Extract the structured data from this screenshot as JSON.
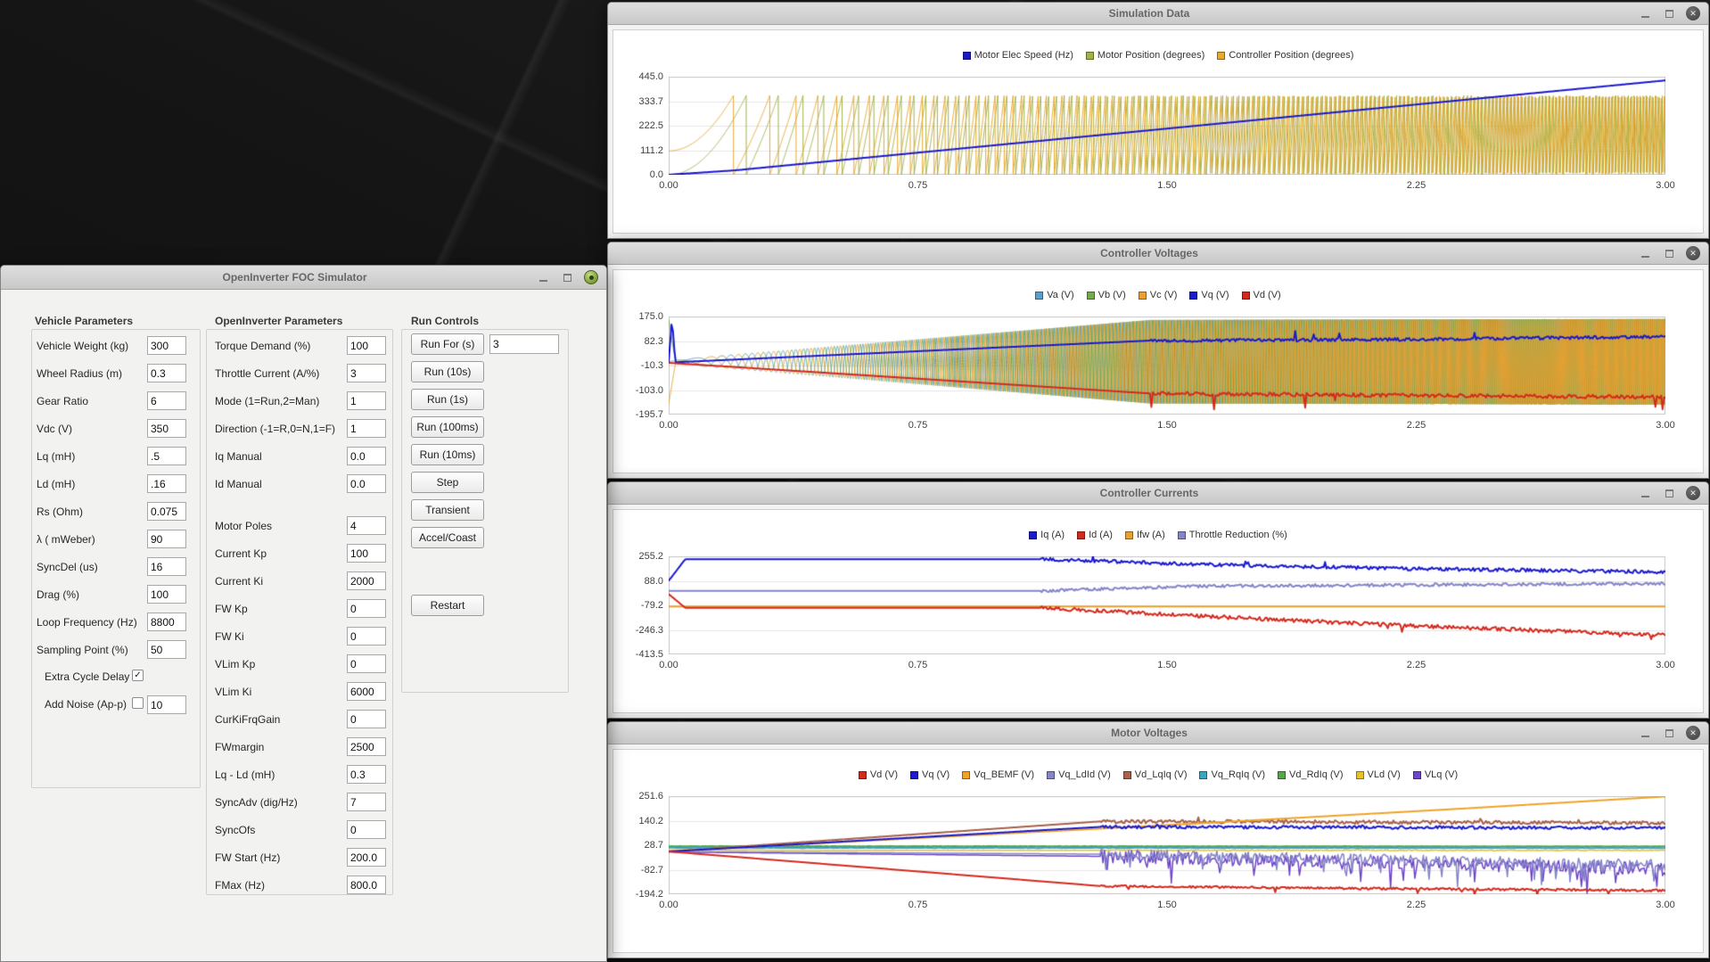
{
  "icons": {
    "close": "✕"
  },
  "simulator": {
    "title": "OpenInverter FOC Simulator",
    "groups": {
      "vehicle": {
        "heading": "Vehicle Parameters",
        "fields": [
          {
            "label": "Vehicle Weight (kg)",
            "value": "300"
          },
          {
            "label": "Wheel Radius (m)",
            "value": "0.3"
          },
          {
            "label": "Gear Ratio",
            "value": "6"
          },
          {
            "label": "Vdc (V)",
            "value": "350"
          },
          {
            "label": "Lq (mH)",
            "value": ".5"
          },
          {
            "label": "Ld (mH)",
            "value": ".16"
          },
          {
            "label": "Rs (Ohm)",
            "value": "0.075"
          },
          {
            "label": "λ ( mWeber)",
            "value": "90"
          },
          {
            "label": "SyncDel (us)",
            "value": "16"
          },
          {
            "label": "Drag (%)",
            "value": "100"
          },
          {
            "label": "Loop Frequency (Hz)",
            "value": "8800"
          },
          {
            "label": "Sampling Point (%)",
            "value": "50"
          }
        ],
        "checks": [
          {
            "label": "Extra Cycle Delay",
            "checked": true
          },
          {
            "label": "Add Noise (Ap-p)",
            "checked": false,
            "value": "10"
          }
        ]
      },
      "openinverter": {
        "heading": "OpenInverter Parameters",
        "fields": [
          {
            "label": "Torque Demand (%)",
            "value": "100"
          },
          {
            "label": "Throttle Current (A/%)",
            "value": "3"
          },
          {
            "label": "Mode (1=Run,2=Man)",
            "value": "1"
          },
          {
            "label": "Direction (-1=R,0=N,1=F)",
            "value": "1"
          },
          {
            "label": "Iq Manual",
            "value": "0.0"
          },
          {
            "label": "Id Manual",
            "value": "0.0"
          },
          {
            "label": "Motor Poles",
            "value": "4"
          },
          {
            "label": "Current Kp",
            "value": "100"
          },
          {
            "label": "Current Ki",
            "value": "2000"
          },
          {
            "label": "FW Kp",
            "value": "0"
          },
          {
            "label": "FW Ki",
            "value": "0"
          },
          {
            "label": "VLim Kp",
            "value": "0"
          },
          {
            "label": "VLim Ki",
            "value": "6000"
          },
          {
            "label": "CurKiFrqGain",
            "value": "0"
          },
          {
            "label": "FWmargin",
            "value": "2500"
          },
          {
            "label": "Lq - Ld (mH)",
            "value": "0.3"
          },
          {
            "label": "SyncAdv (dig/Hz)",
            "value": "7"
          },
          {
            "label": "SyncOfs",
            "value": "0"
          },
          {
            "label": "FW Start (Hz)",
            "value": "200.0"
          },
          {
            "label": "FMax (Hz)",
            "value": "800.0"
          }
        ]
      },
      "run": {
        "heading": "Run Controls",
        "run_for_value": "3",
        "buttons": [
          "Run For (s)",
          "Run (10s)",
          "Run (1s)",
          "Run (100ms)",
          "Run (10ms)",
          "Step",
          "Transient",
          "Accel/Coast",
          "Restart"
        ]
      }
    }
  },
  "chart_data": [
    {
      "window_title": "Simulation Data",
      "type": "line",
      "xlim": [
        0,
        3
      ],
      "ylim": [
        0,
        445
      ],
      "x_ticks": [
        "0.00",
        "0.75",
        "1.50",
        "2.25",
        "3.00"
      ],
      "y_ticks": [
        "445.0",
        "333.7",
        "222.5",
        "111.2",
        "0.0"
      ],
      "series": [
        {
          "name": "Motor Elec Speed (Hz)",
          "color": "#1a1ace",
          "kind": "line",
          "width": 2,
          "z": 9,
          "points": [
            [
              0,
              0
            ],
            [
              0.2,
              20
            ],
            [
              3,
              428
            ]
          ]
        },
        {
          "name": "Motor Position (degrees)",
          "color": "#a2b245",
          "kind": "sawtooth",
          "width": 1,
          "z": 1,
          "min": 0,
          "max": 360,
          "f0": 0,
          "f1": 110
        },
        {
          "name": "Controller Position (degrees)",
          "color": "#e9a82e",
          "kind": "sawtooth",
          "width": 1,
          "z": 2,
          "min": 0,
          "max": 360,
          "f0": 0,
          "f1": 110,
          "phase0": 0.3
        }
      ]
    },
    {
      "window_title": "Controller Voltages",
      "type": "line",
      "xlim": [
        0,
        3
      ],
      "ylim": [
        -195.7,
        175
      ],
      "x_ticks": [
        "0.00",
        "0.75",
        "1.50",
        "2.25",
        "3.00"
      ],
      "y_ticks": [
        "175.0",
        "82.3",
        "-10.3",
        "-103.0",
        "-195.7"
      ],
      "series": [
        {
          "name": "Va (V)",
          "color": "#5aa0c8",
          "kind": "sine_sweep",
          "width": 1,
          "z": 1,
          "f0": 0,
          "f1": 215,
          "phase0": 0,
          "center": 4,
          "amp_points": [
            [
              0,
              185
            ],
            [
              0.02,
              8
            ],
            [
              1.45,
              158
            ],
            [
              3,
              162
            ]
          ]
        },
        {
          "name": "Vb (V)",
          "color": "#74a94c",
          "kind": "sine_sweep",
          "width": 1,
          "z": 2,
          "f0": 0,
          "f1": 215,
          "phase0": 2.094,
          "center": 4,
          "amp_points": [
            [
              0,
              185
            ],
            [
              0.02,
              8
            ],
            [
              1.45,
              158
            ],
            [
              3,
              162
            ]
          ]
        },
        {
          "name": "Vc (V)",
          "color": "#e9a030",
          "kind": "sine_sweep",
          "width": 1,
          "z": 3,
          "f0": 0,
          "f1": 215,
          "phase0": 4.189,
          "center": 4,
          "amp_points": [
            [
              0,
              185
            ],
            [
              0.02,
              8
            ],
            [
              1.45,
              158
            ],
            [
              3,
              162
            ]
          ]
        },
        {
          "name": "Vq (V)",
          "color": "#1a1ace",
          "kind": "line",
          "width": 2,
          "z": 8,
          "points": [
            [
              0,
              2
            ],
            [
              0.01,
              168
            ],
            [
              0.02,
              2
            ],
            [
              1.45,
              84
            ],
            [
              2.2,
              88
            ],
            [
              3,
              99
            ]
          ],
          "noise": 6,
          "noise_from": 1.45,
          "spike_p": 0.012,
          "spike_scale": 5,
          "spike_dir": 1
        },
        {
          "name": "Vd (V)",
          "color": "#d42a1e",
          "kind": "line",
          "width": 2,
          "z": 9,
          "points": [
            [
              0,
              0
            ],
            [
              1.45,
              -116
            ],
            [
              3,
              -130
            ]
          ],
          "noise": 7,
          "noise_from": 1.45,
          "spike_p": 0.014,
          "spike_scale": 6,
          "spike_dir": -1
        }
      ]
    },
    {
      "window_title": "Controller Currents",
      "type": "line",
      "xlim": [
        0,
        3
      ],
      "ylim": [
        -413.5,
        255.2
      ],
      "x_ticks": [
        "0.00",
        "0.75",
        "1.50",
        "2.25",
        "3.00"
      ],
      "y_ticks": [
        "255.2",
        "88.0",
        "-79.2",
        "-246.3",
        "-413.5"
      ],
      "series": [
        {
          "name": "Iq (A)",
          "color": "#1a1ace",
          "kind": "line",
          "width": 2,
          "z": 7,
          "points": [
            [
              0,
              88
            ],
            [
              0.05,
              236
            ],
            [
              1.12,
              236
            ],
            [
              1.6,
              200
            ],
            [
              2.2,
              172
            ],
            [
              3,
              148
            ]
          ],
          "noise": 12,
          "noise_from": 1.12,
          "spike_p": 0.01,
          "spike_scale": 2.5,
          "spike_dir": 1
        },
        {
          "name": "Id (A)",
          "color": "#d42a1e",
          "kind": "line",
          "width": 2,
          "z": 8,
          "points": [
            [
              0,
              -2
            ],
            [
              0.05,
              -96
            ],
            [
              1.12,
              -96
            ],
            [
              1.6,
              -152
            ],
            [
              2.2,
              -215
            ],
            [
              3,
              -282
            ]
          ],
          "noise": 13,
          "noise_from": 1.12,
          "spike_p": 0.01,
          "spike_scale": 2.5,
          "spike_dir": -1
        },
        {
          "name": "Ifw (A)",
          "color": "#e9a030",
          "kind": "line",
          "width": 2,
          "z": 6,
          "points": [
            [
              0,
              -86
            ],
            [
              3,
              -86
            ]
          ]
        },
        {
          "name": "Throttle Reduction (%)",
          "color": "#8585c8",
          "kind": "line",
          "width": 2,
          "z": 5,
          "points": [
            [
              0,
              20
            ],
            [
              1.12,
              20
            ],
            [
              1.6,
              52
            ],
            [
              3,
              70
            ]
          ],
          "noise": 10,
          "noise_from": 1.12
        }
      ]
    },
    {
      "window_title": "Motor Voltages",
      "type": "line",
      "xlim": [
        0,
        3
      ],
      "ylim": [
        -194.2,
        251.6
      ],
      "x_ticks": [
        "0.00",
        "0.75",
        "1.50",
        "2.25",
        "3.00"
      ],
      "y_ticks": [
        "251.6",
        "140.2",
        "28.7",
        "-82.7",
        "-194.2"
      ],
      "series": [
        {
          "name": "Vd (V)",
          "color": "#d42a1e",
          "kind": "line",
          "width": 2,
          "z": 9,
          "points": [
            [
              0,
              0
            ],
            [
              1.3,
              -157
            ],
            [
              2.1,
              -168
            ],
            [
              3,
              -177
            ]
          ],
          "noise": 5,
          "noise_from": 1.3,
          "spike_p": 0.01,
          "spike_scale": 4,
          "spike_dir": -1
        },
        {
          "name": "Vq (V)",
          "color": "#1a1ace",
          "kind": "line",
          "width": 2,
          "z": 8,
          "points": [
            [
              0,
              0
            ],
            [
              1.3,
              112
            ],
            [
              3,
              107
            ]
          ],
          "noise": 7,
          "noise_from": 1.3,
          "spike_p": 0.008,
          "spike_scale": 2,
          "spike_dir": 1
        },
        {
          "name": "Vq_BEMF (V)",
          "color": "#efa428",
          "kind": "line",
          "width": 2,
          "z": 7,
          "points": [
            [
              0,
              2
            ],
            [
              1.5,
              120
            ],
            [
              2.4,
              196
            ],
            [
              3,
              250
            ]
          ]
        },
        {
          "name": "Vq_LdId (V)",
          "color": "#8585c8",
          "kind": "line",
          "width": 1.5,
          "z": 5,
          "points": [
            [
              0,
              0
            ],
            [
              1.3,
              -12
            ],
            [
              2,
              -35
            ],
            [
              3,
              -62
            ]
          ],
          "noise": 26,
          "noise_from": 1.3,
          "spike_p": 0.05,
          "spike_scale": 3,
          "spike_dir": -1
        },
        {
          "name": "Vd_LqIq (V)",
          "color": "#a8614a",
          "kind": "line",
          "width": 2,
          "z": 6,
          "points": [
            [
              0,
              0
            ],
            [
              1.3,
              137
            ],
            [
              3,
              130
            ]
          ],
          "noise": 8,
          "noise_from": 1.3,
          "spike_p": 0.006,
          "spike_scale": 2,
          "spike_dir": 1
        },
        {
          "name": "Vq_RqIq (V)",
          "color": "#3da4c4",
          "kind": "line",
          "width": 2,
          "z": 3,
          "points": [
            [
              0,
              17
            ],
            [
              3,
              16
            ]
          ],
          "noise": 1,
          "noise_from": 0
        },
        {
          "name": "Vd_RdIq (V)",
          "color": "#57a64a",
          "kind": "line",
          "width": 2,
          "z": 2,
          "points": [
            [
              0,
              24
            ],
            [
              3,
              23
            ]
          ],
          "noise": 1,
          "noise_from": 0
        },
        {
          "name": "VLd (V)",
          "color": "#e5c22e",
          "kind": "line",
          "width": 1.5,
          "z": 1,
          "points": [
            [
              0,
              6
            ],
            [
              3,
              5
            ]
          ],
          "noise": 2,
          "noise_from": 1.3
        },
        {
          "name": "VLq (V)",
          "color": "#6f46c8",
          "kind": "line",
          "width": 1.5,
          "z": 4,
          "points": [
            [
              0,
              -2
            ],
            [
              1.3,
              -22
            ],
            [
              3,
              -80
            ]
          ],
          "noise": 30,
          "noise_from": 1.3,
          "spike_p": 0.06,
          "spike_scale": 2.5,
          "spike_dir": -1
        }
      ]
    }
  ]
}
